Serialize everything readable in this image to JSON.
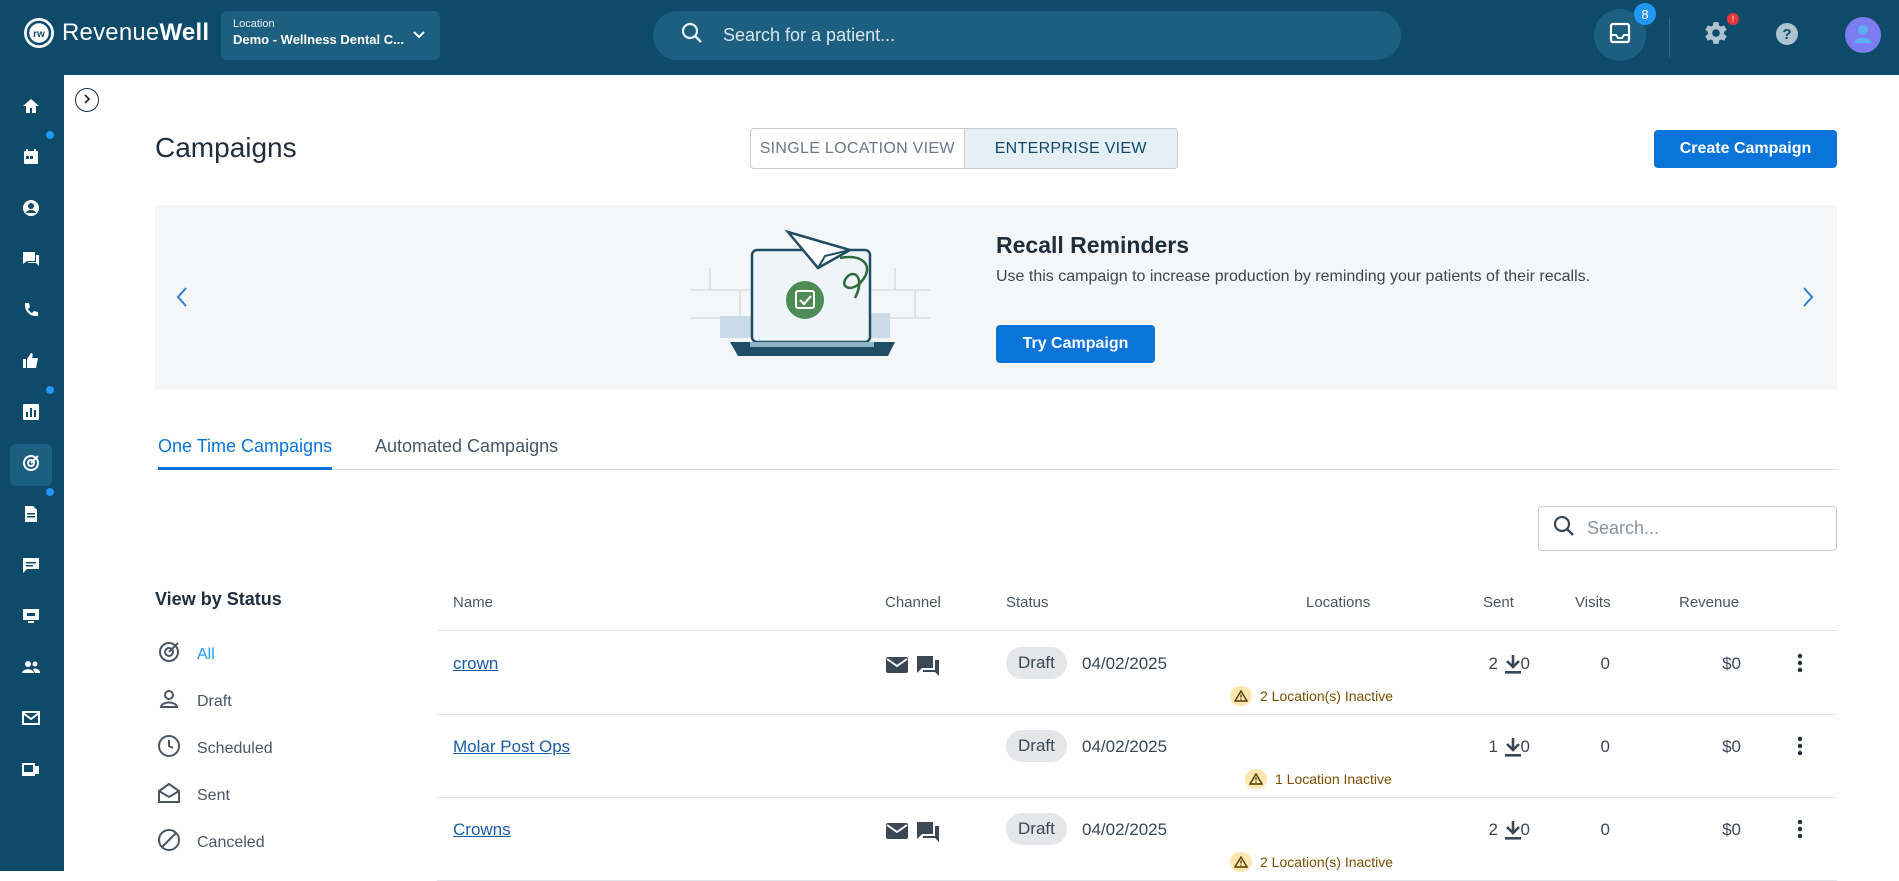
{
  "header": {
    "logo_text_light": "Revenue",
    "logo_text_bold": "Well",
    "location_label": "Location",
    "location_value": "Demo - Wellness Dental C...",
    "search_placeholder": "Search for a patient...",
    "inbox_badge": "8",
    "settings_badge": "!"
  },
  "page": {
    "title": "Campaigns",
    "view_single": "SINGLE LOCATION VIEW",
    "view_enterprise": "ENTERPRISE VIEW",
    "create_button": "Create Campaign"
  },
  "banner": {
    "title": "Recall Reminders",
    "description": "Use this campaign to increase production by reminding your patients of their recalls.",
    "button": "Try Campaign"
  },
  "tabs": [
    "One Time Campaigns",
    "Automated Campaigns"
  ],
  "search": {
    "placeholder": "Search..."
  },
  "status_filter": {
    "title": "View by Status",
    "items": [
      "All",
      "Draft",
      "Scheduled",
      "Sent",
      "Canceled"
    ]
  },
  "table": {
    "headers": [
      "Name",
      "Channel",
      "Status",
      "Locations",
      "Sent",
      "Visits",
      "Revenue"
    ],
    "rows": [
      {
        "name": "crown",
        "status": "Draft",
        "date": "04/02/2025",
        "locations": "2",
        "warning": "2 Location(s) Inactive",
        "sent": "0",
        "visits": "0",
        "revenue": "$0",
        "channels": [
          "email-icon",
          "sms-icon"
        ]
      },
      {
        "name": "Molar Post Ops",
        "status": "Draft",
        "date": "04/02/2025",
        "locations": "1",
        "warning": "1 Location Inactive",
        "sent": "0",
        "visits": "0",
        "revenue": "$0",
        "channels": []
      },
      {
        "name": "Crowns",
        "status": "Draft",
        "date": "04/02/2025",
        "locations": "2",
        "warning": "2 Location(s) Inactive",
        "sent": "0",
        "visits": "0",
        "revenue": "$0",
        "channels": [
          "email-icon",
          "sms-icon"
        ]
      }
    ]
  },
  "colors": {
    "nav_bg": "#0e4b6b",
    "accent": "#0a74da",
    "badge_blue": "#2196f3",
    "alert_red": "#e53935"
  }
}
